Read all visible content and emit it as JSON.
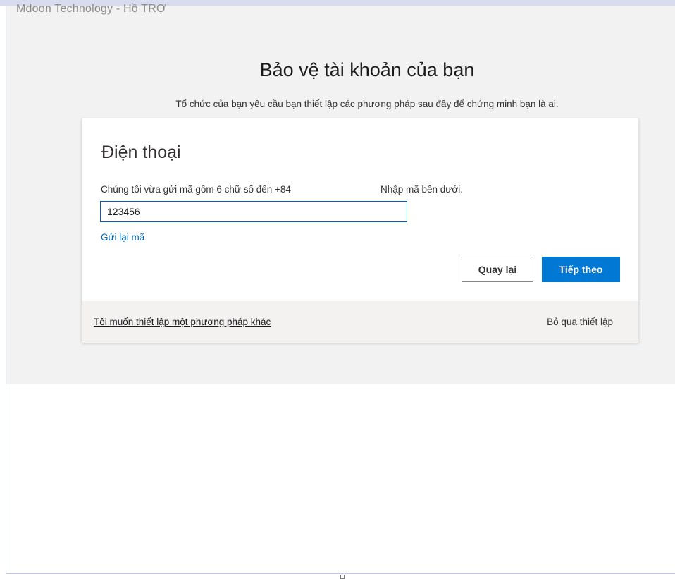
{
  "window": {
    "clipped_title": "Mdoon Technology - Hồ TRỢ"
  },
  "page": {
    "title": "Bảo vệ tài khoản của bạn",
    "subtitle": "Tổ chức của bạn yêu cầu bạn thiết lập các phương pháp sau đây để chứng minh bạn là ai."
  },
  "card": {
    "heading": "Điện thoại",
    "instruction_left": "Chúng tôi vừa gửi mã gồm 6 chữ số đến +84",
    "instruction_right": "Nhập mã bên dưới.",
    "code_input_value": "123456",
    "resend_link": "Gửi lại mã",
    "back_button": "Quay lại",
    "next_button": "Tiếp theo"
  },
  "footer": {
    "other_method_link": "Tôi muốn thiết lập một phương pháp khác",
    "skip_link": "Bỏ qua thiết lập"
  }
}
